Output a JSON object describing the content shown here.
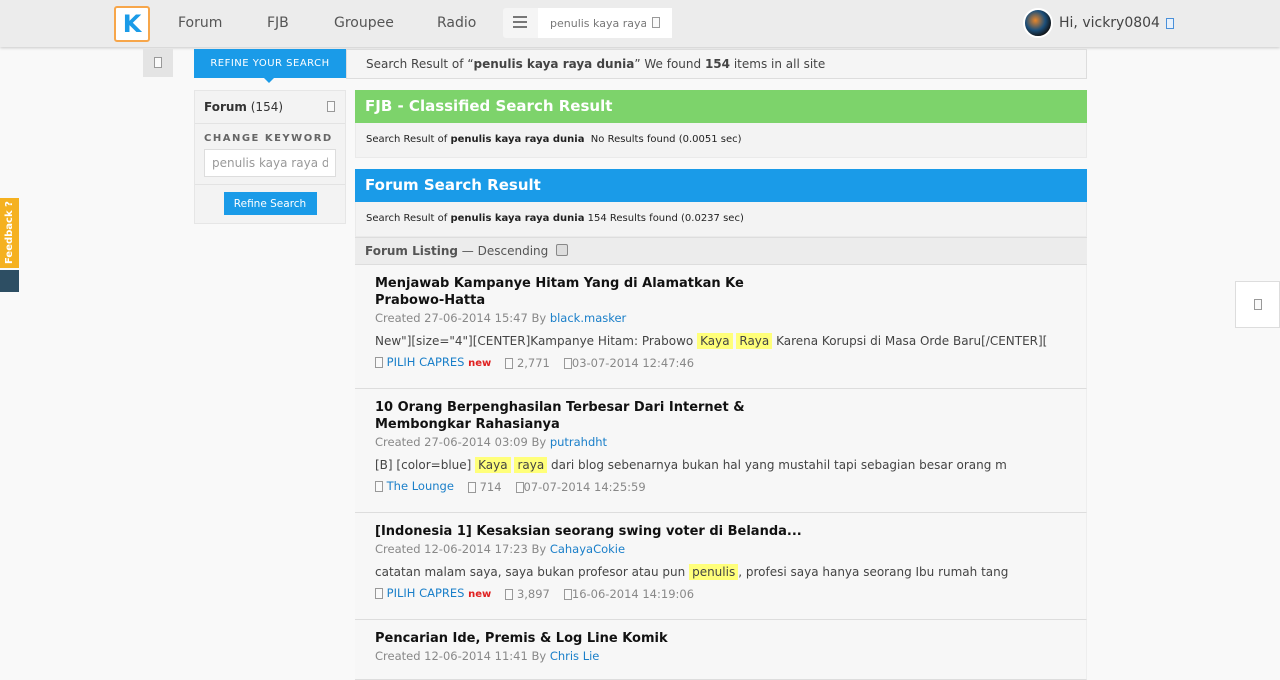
{
  "header": {
    "logo": "K",
    "nav": [
      "Forum",
      "FJB",
      "Groupee",
      "Radio"
    ],
    "search_value": "penulis kaya raya dunia",
    "user_greeting": "Hi, vickry0804"
  },
  "topbar": {
    "refine_tab": "REFINE YOUR SEARCH",
    "prefix": "Search Result of “",
    "query": "penulis kaya raya dunia",
    "mid": "” We found ",
    "count": "154",
    "suffix": " items in all site"
  },
  "sidebar": {
    "forum_label": "Forum",
    "forum_count": "(154)",
    "change_keyword": "CHANGE KEYWORD",
    "keyword_value": "penulis kaya raya dunia",
    "refine_button": "Refine Search"
  },
  "fjb": {
    "title": "FJB - Classified Search Result",
    "prefix": "Search Result of ",
    "query": "penulis kaya raya dunia",
    "result": "  No Results found (0.0051 sec)",
    "color": "#7dd36b"
  },
  "forum": {
    "title": "Forum Search Result",
    "prefix": "Search Result of ",
    "query": "penulis kaya raya dunia",
    "result": " 154 Results found (0.0237 sec)",
    "color": "#1a9be8"
  },
  "listing": {
    "label": "Forum Listing",
    "order": " — Descending"
  },
  "feedback": "Feedback ?",
  "items": [
    {
      "title": "Menjawab Kampanye Hitam Yang di Alamatkan Ke Prabowo-Hatta",
      "created": "Created 27-06-2014 15:47 By ",
      "author": "black.masker",
      "snippet": [
        {
          "t": "New\"][size=\"4\"][CENTER]Kampanye Hitam: Prabowo "
        },
        {
          "t": "Kaya",
          "hl": true
        },
        {
          "t": " "
        },
        {
          "t": "Raya",
          "hl": true
        },
        {
          "t": " Karena Korupsi di Masa Orde Baru[/CENTER]["
        }
      ],
      "forum": "PILIH CAPRES",
      "new": "new",
      "views": "2,771",
      "last": "03-07-2014 12:47:46"
    },
    {
      "title": "10 Orang Berpenghasilan Terbesar Dari Internet & Membongkar Rahasianya",
      "created": "Created 27-06-2014 03:09 By ",
      "author": "putrahdht",
      "snippet": [
        {
          "t": "[B] [color=blue] "
        },
        {
          "t": "Kaya",
          "hl": true
        },
        {
          "t": " "
        },
        {
          "t": "raya",
          "hl": true
        },
        {
          "t": " dari blog sebenarnya bukan hal yang mustahil tapi sebagian besar orang m"
        }
      ],
      "forum": "The Lounge",
      "new": "",
      "views": "714",
      "last": "07-07-2014 14:25:59"
    },
    {
      "title": "[Indonesia 1] Kesaksian seorang swing voter di Belanda...",
      "created": "Created 12-06-2014 17:23 By ",
      "author": "CahayaCokie",
      "snippet": [
        {
          "t": "catatan malam saya, saya bukan profesor atau pun "
        },
        {
          "t": "penulis",
          "hl": true
        },
        {
          "t": ", profesi saya hanya seorang Ibu rumah tang"
        }
      ],
      "forum": "PILIH CAPRES",
      "new": "new",
      "views": "3,897",
      "last": "16-06-2014 14:19:06"
    },
    {
      "title": "Pencarian Ide, Premis & Log Line Komik",
      "created": "Created 12-06-2014 11:41 By ",
      "author": "Chris Lie",
      "snippet": [],
      "forum": "",
      "new": "",
      "views": "",
      "last": ""
    }
  ]
}
